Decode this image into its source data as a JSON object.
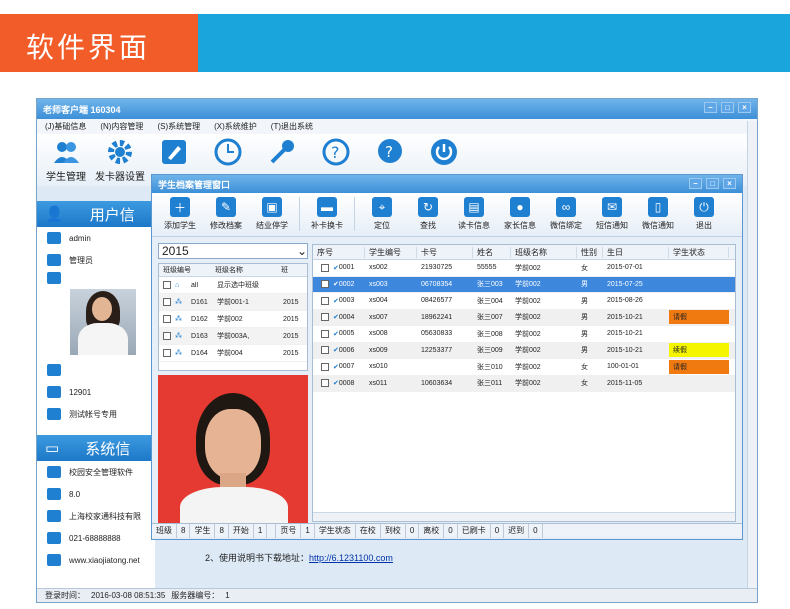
{
  "banner": {
    "title": "软件界面"
  },
  "app": {
    "title": "老师客户端 160304",
    "menu": [
      "(J)基础信息",
      "(N)内容管理",
      "(S)系统管理",
      "(X)系统维护",
      "(T)退出系统"
    ],
    "toolbar": [
      {
        "label": "学生管理",
        "icon": "users-icon"
      },
      {
        "label": "发卡器设置",
        "icon": "gear-icon"
      }
    ],
    "user_section": {
      "title": "用户信",
      "items": [
        "admin",
        "管理员",
        "",
        "12901",
        "测试帐号专用"
      ]
    },
    "sys_section": {
      "title": "系统信",
      "items": [
        "校园安全管理软件",
        "8.0",
        "上海校家通科技有限",
        "021-68888888",
        "www.xiaojiatong.net"
      ]
    },
    "status": {
      "login_label": "登录时间：",
      "login_time": "2016-03-08 08:51:35",
      "server_label": "服务器编号：",
      "server_no": "1"
    },
    "bottom_line2": "2、使用说明书下载地址：",
    "bottom_link": "http://6.1231100.com"
  },
  "dialog": {
    "title": "学生档案管理窗口",
    "toolbar": [
      "添加学生",
      "修改档案",
      "结业停学",
      "补卡换卡",
      "定位",
      "查找",
      "读卡信息",
      "家长信息",
      "微信绑定",
      "短信通知",
      "微信通知",
      "退出"
    ],
    "year": "2015",
    "class_headers": [
      "班级编号",
      "班级名称",
      "班"
    ],
    "classes": [
      {
        "code": "all",
        "name": "显示选中班级",
        "year": ""
      },
      {
        "code": "D161",
        "name": "学前001-1",
        "year": "2015"
      },
      {
        "code": "D162",
        "name": "学前002",
        "year": "2015"
      },
      {
        "code": "D163",
        "name": "学前003A,",
        "year": "2015"
      },
      {
        "code": "D164",
        "name": "学前004",
        "year": "2015"
      }
    ],
    "student_headers": [
      "序号",
      "学生编号",
      "卡号",
      "姓名",
      "班级名称",
      "性别",
      "生日",
      "学生状态"
    ],
    "students": [
      {
        "no": "0001",
        "id": "xs002",
        "card": "21930725",
        "name": "55555",
        "class": "学前002",
        "sex": "女",
        "birth": "2015-07-01",
        "status": ""
      },
      {
        "no": "0002",
        "id": "xs003",
        "card": "06708354",
        "name": "张三003",
        "class": "学前002",
        "sex": "男",
        "birth": "2015-07-25",
        "status": ""
      },
      {
        "no": "0003",
        "id": "xs004",
        "card": "08426577",
        "name": "张三004",
        "class": "学前002",
        "sex": "男",
        "birth": "2015-08-26",
        "status": ""
      },
      {
        "no": "0004",
        "id": "xs007",
        "card": "18962241",
        "name": "张三007",
        "class": "学前002",
        "sex": "男",
        "birth": "2015-10-21",
        "status": "请假"
      },
      {
        "no": "0005",
        "id": "xs008",
        "card": "05630833",
        "name": "张三008",
        "class": "学前002",
        "sex": "男",
        "birth": "2015-10-21",
        "status": ""
      },
      {
        "no": "0006",
        "id": "xs009",
        "card": "12253377",
        "name": "张三009",
        "class": "学前002",
        "sex": "男",
        "birth": "2015-10-21",
        "status": "续假"
      },
      {
        "no": "0007",
        "id": "xs010",
        "card": "",
        "name": "张三010",
        "class": "学前002",
        "sex": "女",
        "birth": "100-01-01",
        "status": "请假"
      },
      {
        "no": "0008",
        "id": "xs011",
        "card": "10603634",
        "name": "张三011",
        "class": "学前002",
        "sex": "女",
        "birth": "2015-11-05",
        "status": ""
      }
    ],
    "summary": [
      "班级",
      "8",
      "学生",
      "8",
      "开始",
      "1",
      "",
      "页号",
      "1",
      "学生状态",
      "在校",
      "到校",
      "0",
      "离校",
      "0",
      "已刷卡",
      "0",
      "迟到",
      "0"
    ]
  },
  "colors": {
    "orange": "#f25c28",
    "blue": "#1aa6dd",
    "selected": "#3d87dd",
    "leave": "#f07a10",
    "continue": "#f5f500"
  }
}
